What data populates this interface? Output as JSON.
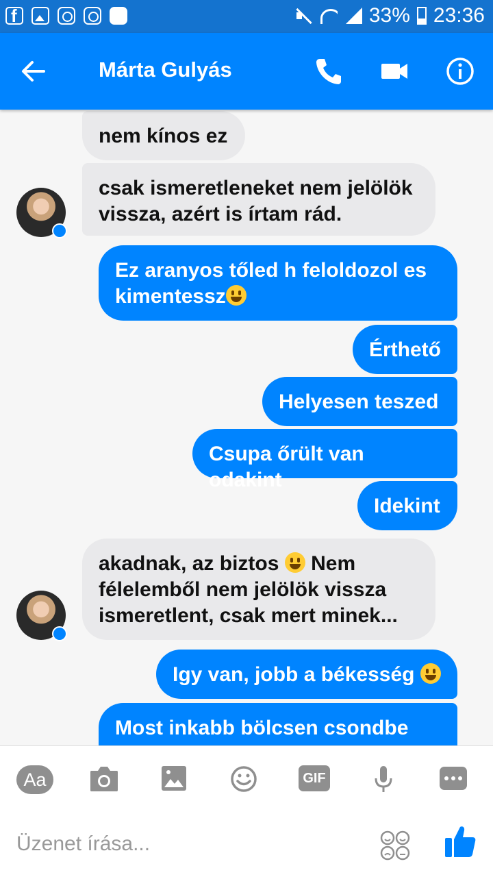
{
  "status_bar": {
    "battery": "33%",
    "time": "23:36",
    "icons": [
      "facebook-icon",
      "gallery-icon",
      "instagram-icon",
      "instagram-icon",
      "galaxy-app-icon",
      "mute-icon",
      "wifi-icon",
      "signal-icon",
      "battery-icon"
    ]
  },
  "header": {
    "contact_name": "Márta Gulyás",
    "icons": [
      "back-arrow-icon",
      "phone-icon",
      "video-icon",
      "info-icon"
    ],
    "color": "#0084ff"
  },
  "messages": [
    {
      "from": "contact",
      "text": "nem kínos ez"
    },
    {
      "from": "contact",
      "lines": [
        "csak ismeretleneket nem jelölök",
        "vissza, azért is írtam rád."
      ]
    },
    {
      "from": "me",
      "lines": [
        "Ez aranyos tőled h feloldozol es",
        "kimentessz"
      ]
    },
    {
      "from": "me",
      "text": "Érthető"
    },
    {
      "from": "me",
      "text": "Helyesen teszed"
    },
    {
      "from": "me",
      "text": "Csupa őrült van odakint"
    },
    {
      "from": "me",
      "text": "Idekint"
    },
    {
      "from": "contact",
      "lines": [
        "akadnak, az biztos",
        "Nem",
        "félelemből nem jelölök vissza",
        "ismeretlent, csak mert minek..."
      ]
    },
    {
      "from": "me",
      "text": "Igy van, jobb a békesség"
    },
    {
      "from": "me",
      "text": "Most inkabb bölcsen csondbe"
    }
  ],
  "composer": {
    "aa_label": "Aa",
    "gif_label": "GIF",
    "placeholder": "Üzenet írása...",
    "icons": [
      "text-style-icon",
      "camera-icon",
      "image-icon",
      "emoji-icon",
      "gif-icon",
      "microphone-icon",
      "more-icon",
      "stickers-icon",
      "like-icon"
    ]
  },
  "colors": {
    "outgoing_bubble": "#0084ff",
    "incoming_bubble": "#e9e9eb",
    "status_bar": "#1473cf"
  }
}
